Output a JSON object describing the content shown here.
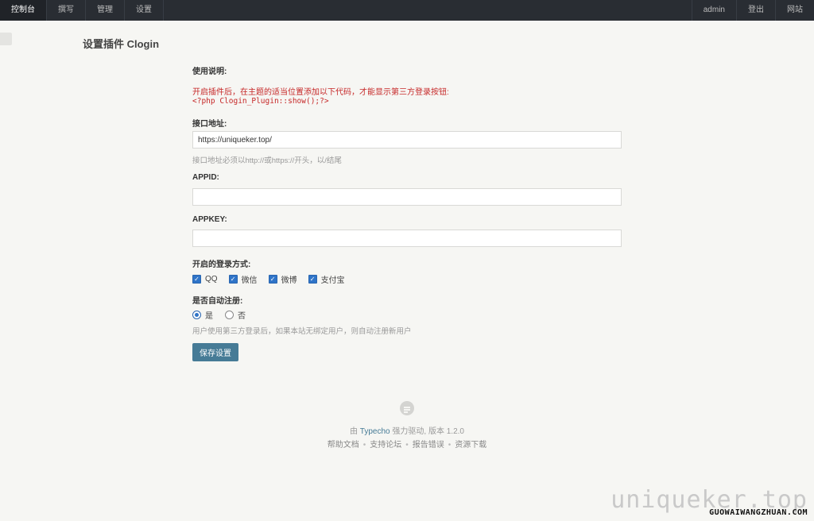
{
  "nav": {
    "left": [
      {
        "label": "控制台",
        "active": true
      },
      {
        "label": "撰写",
        "active": false
      },
      {
        "label": "管理",
        "active": false
      },
      {
        "label": "设置",
        "active": false
      }
    ],
    "right": [
      {
        "label": "admin"
      },
      {
        "label": "登出"
      },
      {
        "label": "网站"
      }
    ]
  },
  "page": {
    "title": "设置插件 Clogin"
  },
  "form": {
    "usage": {
      "label": "使用说明:",
      "desc": "开启插件后，在主题的适当位置添加以下代码，才能显示第三方登录按钮:",
      "code": "<?php Clogin_Plugin::show();?>"
    },
    "api": {
      "label": "接口地址:",
      "value": "https://uniqueker.top/",
      "hint": "接口地址必须以http://或https://开头，以/结尾"
    },
    "appid": {
      "label": "APPID:",
      "value": ""
    },
    "appkey": {
      "label": "APPKEY:",
      "value": ""
    },
    "methods": {
      "label": "开启的登录方式:",
      "options": [
        {
          "label": "QQ",
          "checked": true
        },
        {
          "label": "微信",
          "checked": true
        },
        {
          "label": "微博",
          "checked": true
        },
        {
          "label": "支付宝",
          "checked": true
        }
      ]
    },
    "autoreg": {
      "label": "是否自动注册:",
      "options": [
        {
          "label": "是",
          "selected": true
        },
        {
          "label": "否",
          "selected": false
        }
      ],
      "hint": "用户使用第三方登录后，如果本站无绑定用户，则自动注册新用户"
    },
    "save_label": "保存设置"
  },
  "footer": {
    "powered_prefix": "由",
    "powered_link": "Typecho",
    "powered_suffix": "强力驱动, 版本 1.2.0",
    "links": [
      "帮助文档",
      "支持论坛",
      "报告错误",
      "资源下载"
    ]
  },
  "watermark": {
    "main": "uniqueker.top",
    "sub": "GUOWAIWANGZHUAN.COM"
  },
  "colors": {
    "topbar": "#292d33",
    "background": "#f6f6f3",
    "primary": "#467b96",
    "checkbox": "#2f74c8",
    "warning_text": "#c62828"
  }
}
